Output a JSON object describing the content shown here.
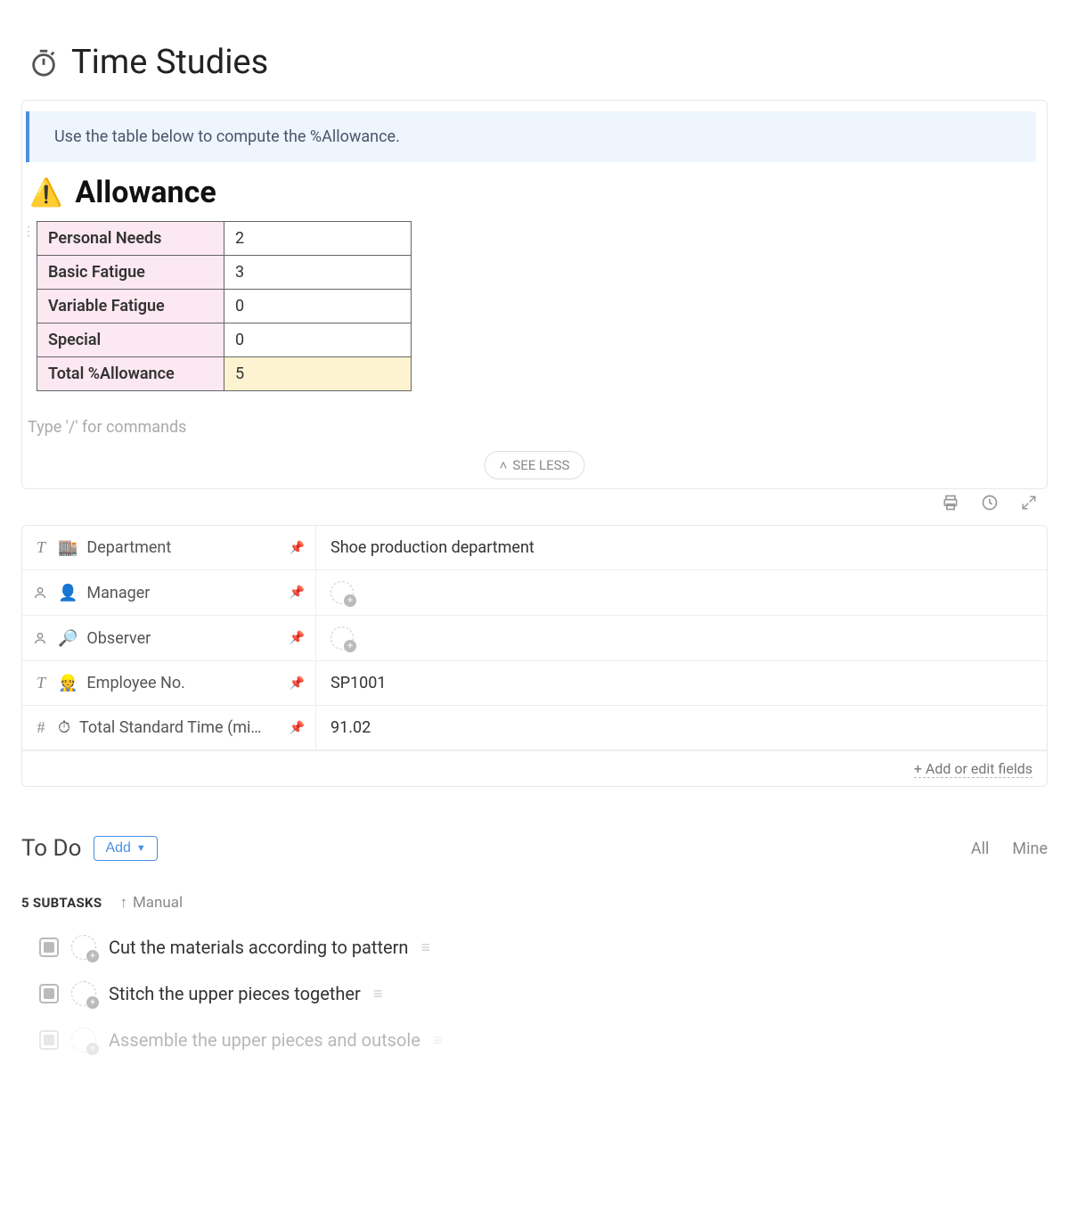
{
  "page": {
    "title": "Time Studies"
  },
  "callout": {
    "text": "Use the table below to compute the %Allowance."
  },
  "allowance": {
    "heading": "Allowance",
    "rows": [
      {
        "label": "Personal Needs",
        "value": "2"
      },
      {
        "label": "Basic Fatigue",
        "value": "3"
      },
      {
        "label": "Variable Fatigue",
        "value": "0"
      },
      {
        "label": "Special",
        "value": "0"
      }
    ],
    "total": {
      "label": "Total %Allowance",
      "value": "5"
    }
  },
  "slash_placeholder": "Type '/' for commands",
  "see_less": "SEE LESS",
  "fields": [
    {
      "type": "T",
      "emoji": "🏬",
      "label": "Department",
      "value": "Shoe production department",
      "pinned": true,
      "kind": "text"
    },
    {
      "type": "person",
      "emoji": "👤",
      "label": "Manager",
      "value": "",
      "pinned": true,
      "kind": "person"
    },
    {
      "type": "person",
      "emoji": "🔎",
      "label": "Observer",
      "value": "",
      "pinned": true,
      "kind": "person"
    },
    {
      "type": "T",
      "emoji": "👷",
      "label": "Employee No.",
      "value": "SP1001",
      "pinned": true,
      "kind": "text"
    },
    {
      "type": "#",
      "emoji": "⏱",
      "label": "Total Standard Time (mi…",
      "value": "91.02",
      "pinned": true,
      "kind": "number"
    }
  ],
  "add_edit_fields": "+ Add or edit fields",
  "todo": {
    "title": "To Do",
    "add_label": "Add",
    "filters": {
      "all": "All",
      "mine": "Mine"
    },
    "subtasks_count": "5 SUBTASKS",
    "sort_label": "Manual",
    "tasks": [
      {
        "title": "Cut the materials according to pattern"
      },
      {
        "title": "Stitch the upper pieces together"
      },
      {
        "title": "Assemble the upper pieces and outsole"
      }
    ]
  }
}
